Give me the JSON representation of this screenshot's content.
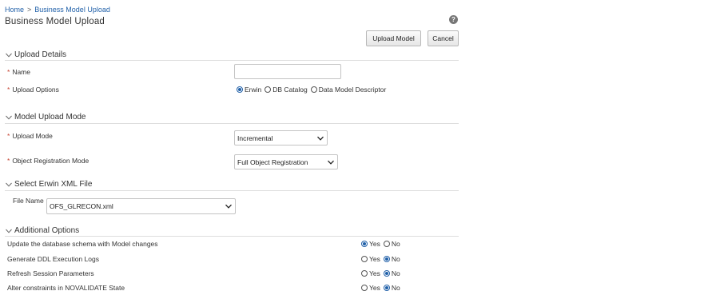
{
  "breadcrumb": {
    "home": "Home",
    "separator": ">",
    "current": "Business Model Upload"
  },
  "page_title": "Business Model Upload",
  "help_icon": "?",
  "toolbar": {
    "upload_label": "Upload Model",
    "cancel_label": "Cancel"
  },
  "sections": {
    "upload_details": {
      "title": "Upload Details",
      "name_label": "Name",
      "name_value": "",
      "options_label": "Upload Options",
      "options": [
        {
          "label": "Erwin",
          "selected": true
        },
        {
          "label": "DB Catalog",
          "selected": false
        },
        {
          "label": "Data Model Descriptor",
          "selected": false
        }
      ]
    },
    "model_upload_mode": {
      "title": "Model Upload Mode",
      "upload_mode_label": "Upload Mode",
      "upload_mode_value": "Incremental",
      "registration_label": "Object Registration Mode",
      "registration_value": "Full Object Registration"
    },
    "erwin_file": {
      "title": "Select Erwin XML File",
      "file_label": "File Name",
      "file_value": "OFS_GLRECON.xml"
    },
    "additional": {
      "title": "Additional Options",
      "yes_label": "Yes",
      "no_label": "No",
      "rows": [
        {
          "label": "Update the database schema with Model changes",
          "value": "Yes"
        },
        {
          "label": "Generate DDL Execution Logs",
          "value": "No"
        },
        {
          "label": "Refresh Session Parameters",
          "value": "No"
        },
        {
          "label": "Alter constraints in NOVALIDATE State",
          "value": "No"
        }
      ]
    }
  },
  "required_marker": "*",
  "colors": {
    "link": "#1f5fa8",
    "required": "#c74634",
    "radio_selected": "#1f5fa8"
  }
}
